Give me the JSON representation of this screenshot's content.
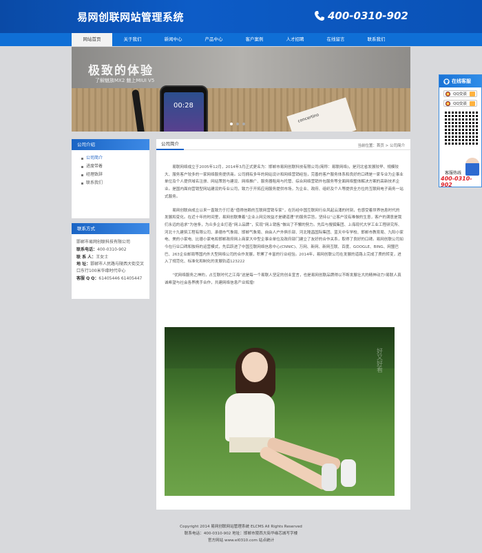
{
  "header": {
    "site_title": "易网创联网站管理系统",
    "phone": "400-0310-902"
  },
  "nav": {
    "items": [
      {
        "label": "网站首页",
        "active": true
      },
      {
        "label": "关于我们"
      },
      {
        "label": "新闻中心"
      },
      {
        "label": "产品中心"
      },
      {
        "label": "客户案例"
      },
      {
        "label": "人才招聘"
      },
      {
        "label": "在线留言"
      },
      {
        "label": "联系我们"
      }
    ]
  },
  "banner": {
    "slogan": "极致的体验",
    "subtitle": "了解魅族MX2 魅上MIUI V5",
    "clock": "00:28",
    "card_text": "concertino"
  },
  "sidebar": {
    "company_intro": {
      "title": "公司介绍",
      "items": [
        "公司简介",
        "进度带着",
        "经理致辞",
        "联系我们"
      ]
    },
    "contact": {
      "title": "联系方式",
      "company": "邯郸市易网创联科技有限公司",
      "phone_label": "联系电话：",
      "phone": "400-0310-902",
      "contact_person_label": "联 系 人：",
      "contact_person": "王女士",
      "address_label": "地    址：",
      "address": "邯郸市人民路与陵西大街交叉口东行100米华缘时代中心",
      "qq_label": "客服 Q Q：",
      "qq": "61405446 61405447"
    }
  },
  "main": {
    "heading": "公司简介",
    "breadcrumb": "当前位置：首页 > 公司简介",
    "paragraphs": [
      "易联网络成立于2005年12月，2014年3月正式更名为：邯郸市易网创联科技有限公司(简称：易联网络)，是河北省发展较早、规模较大、服务客户较多的一家网络服务提供商。公司拥有多年的网站设计和网络营销经验，完善的客户服务体系和良好的口碑是一家专业为企事业单位及个人提供域名注册、网站策划与建设、网络推广、服务器租用与托管、综合网络营销外包服务等全面网络整体解决方案的高新技术企业。是国内面向营销型网站建设的专业公司，致力于开拓应用服务提供市场，为企业、政府、组织及个人等提供全方位的互联网电子商务一站式服务。",
      "易网创联自成立以来一直致力于打造“值得信赖的互联网营销专家”，在历经中国互联网行业风起云涌的时刻，也感受着世界信息时代的发展和变化。在近十年的时间里，易网创联秉着“企业上网见效益才是硬道理”的服务宗旨，坚持以“让客户没有难做的生意，客户的满意是我们永远的追求”为信条，为众多企业打造“网上品牌”，实现“网上销售”做出了不懈的努力。先后与搜狐集团、上海现代大学工业工程研究所、河北十九建筑工程有限公司、承德市气象局、邯郸气象局、自由人户外俱乐部、河北隆昌国际集团、蓝天中专学校、邯郸市教育局、九阳小家电、美的小家电、比德小家电和邯郸政府网上商家大中型企事业单位及政府部门建立了友好的合作关系，取得了良好的口碑。易网创联公司如今在行业口碑和独特的运营模式，先后跃进了中国互联网络信息中心(CNNIC)、万网、新网、新网互联、百度、GOOGLE、BING、网盟巴巴、263企业邮局等国内外大型网络公司的合作发展，积累了丰富的行业经验。2014年，易网创联公司在发展的道路上完成了质的转变，进入了规范化、标准化和制化的发展轨道123222",
      "“优网络服务之神的，占互联时代之江海”这是每一个易联人坚定的创业宣言，也是易网创联品牌得以不断发展壮大的精神动力!易联人真诚希望与社会各界携手合作，共建网络信息产业辉煌!"
    ],
    "photo_watermark": "好又好看"
  },
  "footer": {
    "copyright": "Copyright 2014 易网创联网站管理系统 ELCMS All Rights Reserved",
    "contact_line": "联系电话：400-0310-902 地址：邯郸市陵西大街华缘芯城写字楼",
    "site_line": "官方网站 www.el0310.com 站点统计"
  },
  "float_service": {
    "title": "在线客服",
    "qq_items": [
      "QQ交谈",
      "QQ交谈"
    ],
    "hotline_label": "客服热线",
    "hotline": "400-0310-902"
  },
  "colors": {
    "header_blue": "#0a4aa6",
    "nav_blue": "#0f6fd6",
    "accent_red": "#e0242b"
  }
}
